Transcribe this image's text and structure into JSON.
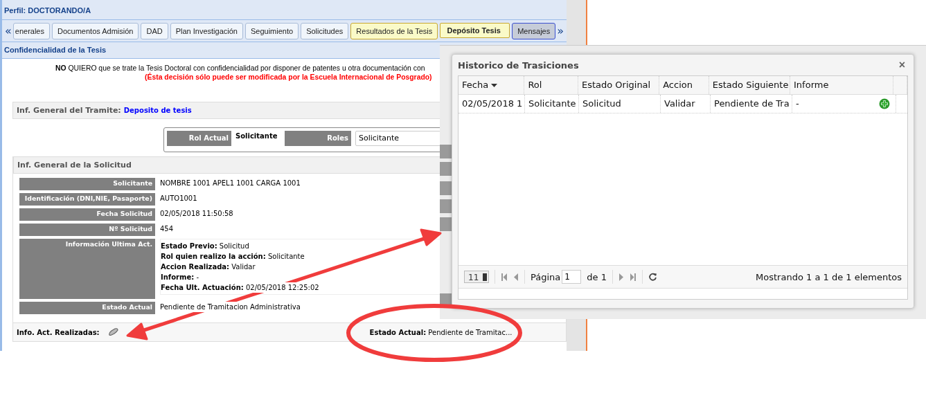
{
  "profile": {
    "title": "Perfil: DOCTORANDO/A"
  },
  "tab_nav": {
    "prev": "«",
    "next": "»"
  },
  "tabs": [
    {
      "label": "enerales",
      "highlighted": false,
      "selected": false
    },
    {
      "label": "Documentos Admisión",
      "highlighted": false,
      "selected": false
    },
    {
      "label": "DAD",
      "highlighted": false,
      "selected": false
    },
    {
      "label": "Plan Investigación",
      "highlighted": false,
      "selected": false
    },
    {
      "label": "Seguimiento",
      "highlighted": false,
      "selected": false
    },
    {
      "label": "Solicitudes",
      "highlighted": false,
      "selected": false
    },
    {
      "label": "Resultados de la Tesis",
      "highlighted": true,
      "selected": false
    },
    {
      "label": "Depósito Tesis",
      "highlighted": true,
      "selected": true
    },
    {
      "label": "Mensajes",
      "highlighted": false,
      "selected": false,
      "focused": true
    }
  ],
  "confidentiality": {
    "title": "Confidencialidad de la Tesis",
    "statement": "**NO** QUIERO que se trate la Tesis Doctoral con confidencialidad por disponer de patentes u otra documentación con",
    "warning": "(Ésta decisión sólo puede ser modificada por la Escuela Internacional de Posgrado)"
  },
  "tramite": {
    "label": "Inf. General del Tramite:",
    "value": "Deposito de tesis"
  },
  "role_box": {
    "current_label": "Rol Actual",
    "current_value": "Solicitante",
    "roles_label": "Roles",
    "roles_value": "Solicitante"
  },
  "solicitud": {
    "title": "Inf. General de la Solicitud",
    "fields": [
      {
        "kind": "value",
        "label": "Solicitante",
        "value": "NOMBRE 1001 APEL1 1001 CARGA 1001"
      },
      {
        "kind": "value",
        "label": "Identificación (DNI,NIE, Pasaporte)",
        "value": "AUTO1001"
      },
      {
        "kind": "value",
        "label": "Fecha Solicitud",
        "value": "02/05/2018 11:50:58"
      },
      {
        "kind": "value",
        "label": "Nº Solicitud",
        "value": "454"
      },
      {
        "kind": "lines",
        "label": "Información Ultima Act.",
        "lines": [
          "**Estado Previo:** Solicitud",
          "**Rol quien realizo la acción:** Solicitante",
          "**Accion Realizada:** Validar",
          "**Informe:** -",
          "**Fecha Ult. Actuación:** 02/05/2018 12:25:02"
        ]
      },
      {
        "kind": "value",
        "label": "Estado Actual",
        "value": "Pendiente de Tramitacion Administrativa"
      }
    ]
  },
  "footer": {
    "label": "Info. Act. Realizadas:",
    "status_label": "Estado Actual:",
    "status_value": "Pendiente de Tramitac..."
  },
  "dialog": {
    "title": "Historico de Trasiciones",
    "close": "×",
    "columns": [
      {
        "label": "Fecha",
        "sorted": true
      },
      {
        "label": "Rol",
        "sorted": false
      },
      {
        "label": "Estado Original",
        "sorted": false
      },
      {
        "label": "Accion",
        "sorted": false
      },
      {
        "label": "Estado Siguiente",
        "sorted": false
      },
      {
        "label": "Informe",
        "sorted": false
      }
    ],
    "rows": [
      {
        "cells": [
          "02/05/2018 1",
          "Solicitante",
          "Solicitud",
          "Validar",
          "Pendiente de Tra",
          "-"
        ]
      }
    ],
    "pager": {
      "page_size": "11",
      "page_label": "Página",
      "page_value": "1",
      "of_label": "de 1",
      "summary": "Mostrando 1 a 1 de 1 elementos"
    }
  }
}
